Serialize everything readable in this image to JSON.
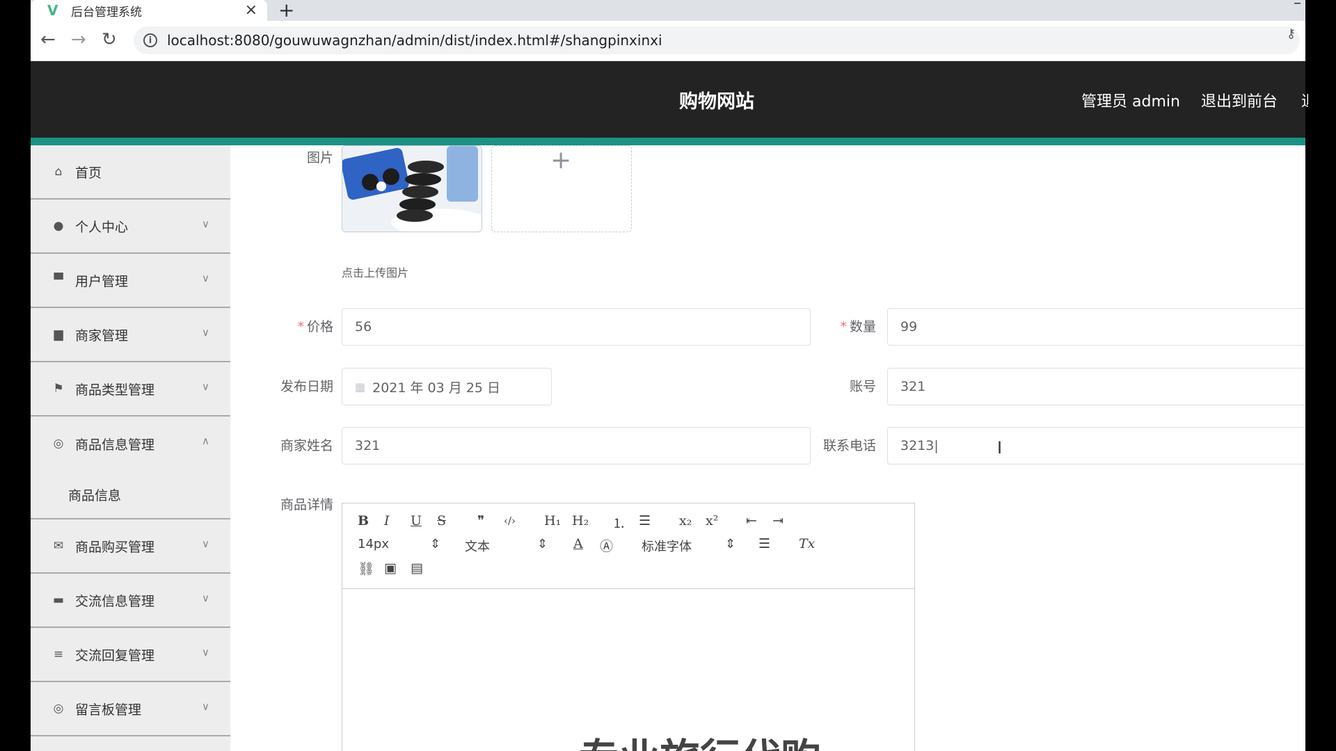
{
  "browser": {
    "tab_title": "后台管理系统",
    "tab_close": "×",
    "new_tab": "+",
    "minimize": "–",
    "url": "localhost:8080/gouwuwagnzhan/admin/dist/index.html#/shangpinxinxi",
    "back": "←",
    "forward": "→",
    "reload": "↻",
    "info": "i",
    "key": "⚷"
  },
  "header": {
    "title": "购物网站",
    "admin": "管理员 admin",
    "exit": "退出到前台",
    "cut_item": "退"
  },
  "sidebar": {
    "items": [
      {
        "label": "首页",
        "icon": "home-icon",
        "glyph": "⌂",
        "arrow": ""
      },
      {
        "label": "个人中心",
        "icon": "user-icon",
        "glyph": "●",
        "arrow": "∨"
      },
      {
        "label": "用户管理",
        "icon": "user-manage-icon",
        "glyph": "▀",
        "arrow": "∨"
      },
      {
        "label": "商家管理",
        "icon": "merchant-icon",
        "glyph": "▆",
        "arrow": "∨"
      },
      {
        "label": "商品类型管理",
        "icon": "flag-icon",
        "glyph": "⚑",
        "arrow": "∨"
      },
      {
        "label": "商品信息管理",
        "icon": "compass-icon",
        "glyph": "◎",
        "arrow": "∧"
      }
    ],
    "sub_item": "商品信息",
    "items_after": [
      {
        "label": "商品购买管理",
        "icon": "mail-icon",
        "glyph": "✉",
        "arrow": "∨"
      },
      {
        "label": "交流信息管理",
        "icon": "chat-icon",
        "glyph": "▬",
        "arrow": "∨"
      },
      {
        "label": "交流回复管理",
        "icon": "sliders-icon",
        "glyph": "≡",
        "arrow": "∨"
      },
      {
        "label": "留言板管理",
        "icon": "circle-icon",
        "glyph": "◎",
        "arrow": "∨"
      }
    ]
  },
  "form": {
    "image_label": "图片",
    "upload_tip": "点击上传图片",
    "plus": "+",
    "price_label": "价格",
    "price_value": "56",
    "quantity_label": "数量",
    "quantity_value": "99",
    "date_label": "发布日期",
    "date_value": "2021 年 03 月 25 日",
    "date_icon": "▦",
    "account_label": "账号",
    "account_value": "321",
    "merchant_name_label": "商家姓名",
    "merchant_name_value": "321",
    "phone_label": "联系电话",
    "phone_value": "3213|",
    "detail_label": "商品详情",
    "required_mark": "*",
    "text_cursor": "I"
  },
  "editor": {
    "bold": "B",
    "italic": "I",
    "underline": "U",
    "strike": "S",
    "quote": "❞",
    "code": "‹/›",
    "h1": "H₁",
    "h2": "H₂",
    "ordered_list": "⒈",
    "bullet_list": "☰",
    "subscript": "x₂",
    "superscript": "x²",
    "outdent": "⇤",
    "indent": "⇥",
    "size": "14px",
    "size_caret": "⇕",
    "format": "文本",
    "format_caret": "⇕",
    "font_color": "A",
    "bg_color": "Ⓐ",
    "font": "标准字体",
    "font_caret": "⇕",
    "align": "☰",
    "clean": "Tx",
    "link": "⛓",
    "image": "▣",
    "video": "▤",
    "content_text": "专业旅行代购"
  },
  "colors": {
    "accent": "#1a9384",
    "header_bg": "#232323",
    "sidebar_bg": "#ededed",
    "required": "#f56c6c"
  }
}
